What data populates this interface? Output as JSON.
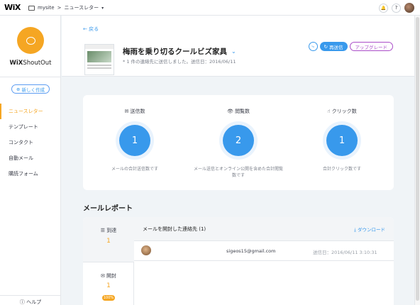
{
  "topbar": {
    "logo": "WiX",
    "site": "mysite",
    "separator": ">",
    "section": "ニュースレター",
    "caret": "▾",
    "bell": "🔔",
    "help": "?"
  },
  "sidebar": {
    "app_name_bold": "WiX",
    "app_name_rest": "ShoutOut",
    "new_button": "新しく作成",
    "items": [
      {
        "label": "ニュースレター",
        "active": true
      },
      {
        "label": "テンプレート",
        "active": false
      },
      {
        "label": "コンタクト",
        "active": false
      },
      {
        "label": "自動メール",
        "active": false
      },
      {
        "label": "購読フォーム",
        "active": false
      }
    ],
    "help": "ヘルプ"
  },
  "header": {
    "back": "戻る",
    "title": "梅雨を乗り切るクールビズ家具",
    "subtitle": "* 1 件の連絡先に送信しました。送信日：2016/06/11",
    "resend": "再送信",
    "upgrade": "アップグレード"
  },
  "stats": [
    {
      "icon": "✉",
      "label": "送信数",
      "value": "1",
      "desc": "メールの合計送信数です"
    },
    {
      "icon": "👁",
      "label": "閲覧数",
      "value": "2",
      "desc": "メール送信とオンライン公開を含めた合計閲覧数です"
    },
    {
      "icon": "☝",
      "label": "クリック数",
      "value": "1",
      "desc": "合計クリック数です"
    }
  ],
  "report": {
    "section_title": "メールレポート",
    "tabs": [
      {
        "label": "到達",
        "count": "1"
      },
      {
        "label": "開封",
        "count": "1",
        "badge": "100%"
      }
    ],
    "list_title": "メールを開封した連絡先 (1)",
    "download": "ダウンロード",
    "rows": [
      {
        "email": "sigeos15@gmail.com",
        "date": "送信日：2016/06/11 3:10:31"
      }
    ]
  }
}
